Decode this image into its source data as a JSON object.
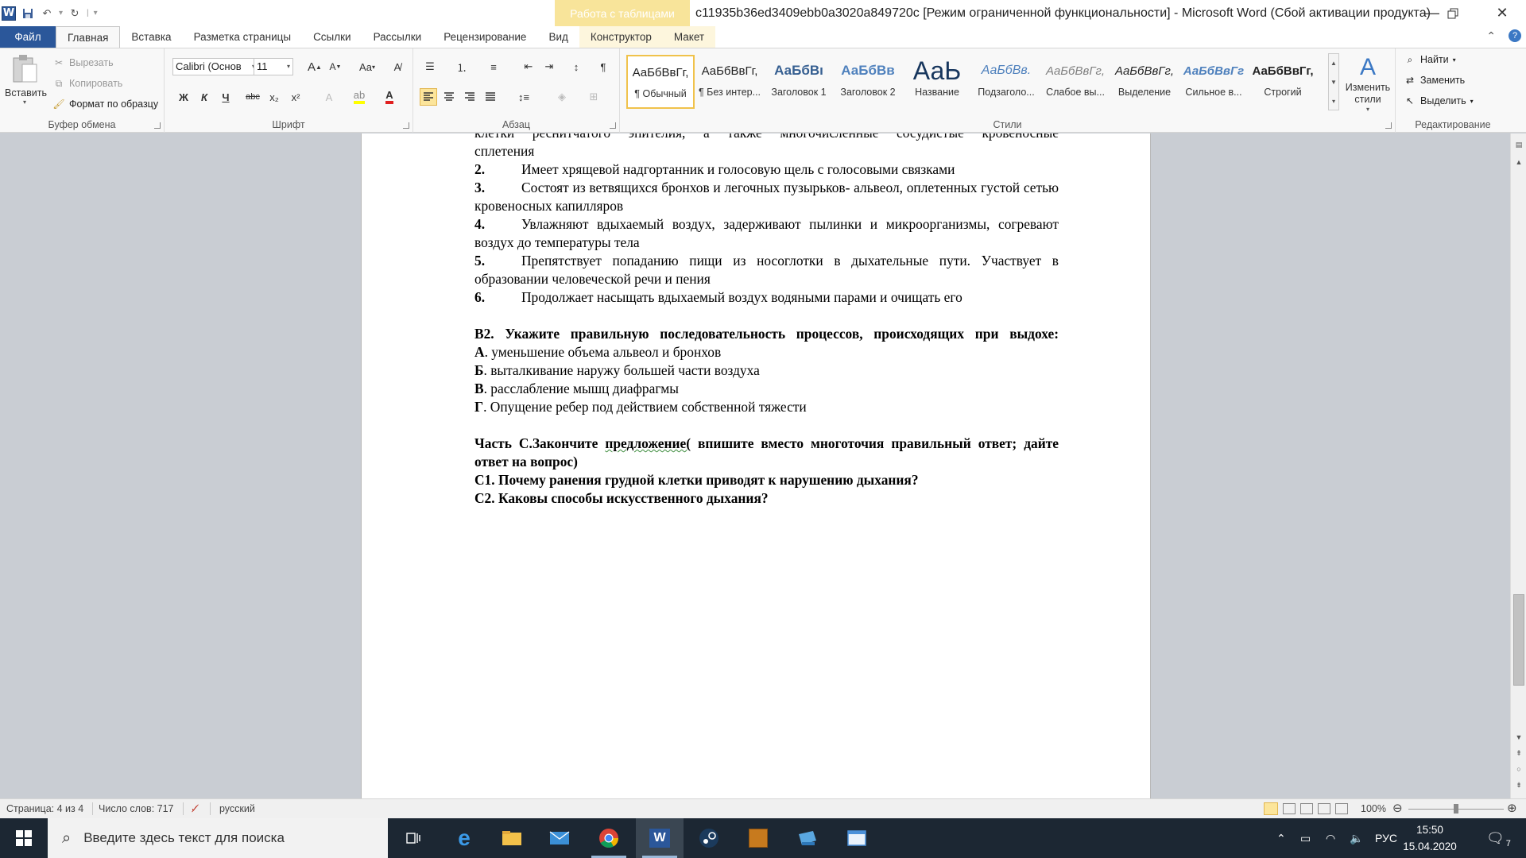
{
  "window": {
    "title": "c11935b36ed3409ebb0a3020a849720c [Режим ограниченной функциональности]  -  Microsoft Word (Сбой активации продукта)",
    "context_tab_header": "Работа с таблицами",
    "app_logo": "W"
  },
  "tabs": [
    "Файл",
    "Главная",
    "Вставка",
    "Разметка страницы",
    "Ссылки",
    "Рассылки",
    "Рецензирование",
    "Вид",
    "Конструктор",
    "Макет"
  ],
  "ribbon": {
    "clipboard": {
      "label": "Буфер обмена",
      "paste": "Вставить",
      "cut": "Вырезать",
      "copy": "Копировать",
      "format_painter": "Формат по образцу"
    },
    "font": {
      "label": "Шрифт",
      "font_name": "Calibri (Основ",
      "font_size": "11",
      "grow": "A",
      "shrink": "A",
      "case": "Aa",
      "bold": "Ж",
      "italic": "К",
      "underline": "Ч",
      "strike": "abc",
      "sub": "x₂",
      "sup": "x²"
    },
    "paragraph": {
      "label": "Абзац",
      "pilcrow": "¶"
    },
    "styles": {
      "label": "Стили",
      "items": [
        {
          "sample": "АаБбВвГг,",
          "name": "¶ Обычный"
        },
        {
          "sample": "АаБбВвГг,",
          "name": "¶ Без интер..."
        },
        {
          "sample": "АаБбВı",
          "name": "Заголовок 1"
        },
        {
          "sample": "АаБбВв",
          "name": "Заголовок 2"
        },
        {
          "sample": "АаЬ",
          "name": "Название"
        },
        {
          "sample": "АаБбВв.",
          "name": "Подзаголо..."
        },
        {
          "sample": "АаБбВвГг,",
          "name": "Слабое вы..."
        },
        {
          "sample": "АаБбВвГг,",
          "name": "Выделение"
        },
        {
          "sample": "АаБбВвГг",
          "name": "Сильное в..."
        },
        {
          "sample": "АаБбВвГг,",
          "name": "Строгий"
        }
      ],
      "change_styles": "Изменить стили"
    },
    "editing": {
      "label": "Редактирование",
      "find": "Найти",
      "replace": "Заменить",
      "select": "Выделить"
    }
  },
  "document": {
    "cont_line": "клетки реснитчатого эпителия, а также многочисленные сосудистые кровеносные",
    "cont_line2": "сплетения",
    "items": [
      {
        "num": "2.",
        "text": "Имеет хрящевой надгортанник и голосовую щель с голосовыми связками"
      },
      {
        "num": "3.",
        "text": "Состоят из ветвящихся бронхов и легочных пузырьков- альвеол, оплетенных густой сетью кровеносных капилляров"
      },
      {
        "num": "4.",
        "text": "Увлажняют вдыхаемый воздух, задерживают пылинки и микроорганизмы, согревают воздух до температуры тела"
      },
      {
        "num": "5.",
        "text": "Препятствует попаданию пищи из носоглотки в дыхательные пути. Участвует в образовании человеческой речи и пения"
      },
      {
        "num": "6.",
        "text": "Продолжает насыщать вдыхаемый воздух водяными парами и очищать его"
      }
    ],
    "b2_title": "В2. Укажите правильную последовательность процессов, происходящих при выдохе:",
    "b2_options": [
      {
        "letter": "А",
        "text": ". уменьшение объема альвеол и бронхов"
      },
      {
        "letter": "Б",
        "text": ". выталкивание наружу большей части воздуха"
      },
      {
        "letter": "В",
        "text": ". расслабление мышц диафрагмы"
      },
      {
        "letter": "Г",
        "text": ". Опущение ребер под действием собственной тяжести"
      }
    ],
    "part_c_a": "Часть С.Закончите ",
    "part_c_b": "предложение(",
    "part_c_c": " впишите вместо многоточия правильный ответ; дайте ответ на вопрос)",
    "c1": "С1. Почему ранения грудной клетки приводят к нарушению дыхания?",
    "c2": "С2. Каковы способы искусственного дыхания?"
  },
  "statusbar": {
    "page": "Страница: 4 из 4",
    "words": "Число слов: 717",
    "language": "русский",
    "zoom": "100%"
  },
  "taskbar": {
    "search_placeholder": "Введите здесь текст для поиска",
    "lang": "РУС",
    "time": "15:50",
    "date": "15.04.2020",
    "notifications": "7"
  }
}
